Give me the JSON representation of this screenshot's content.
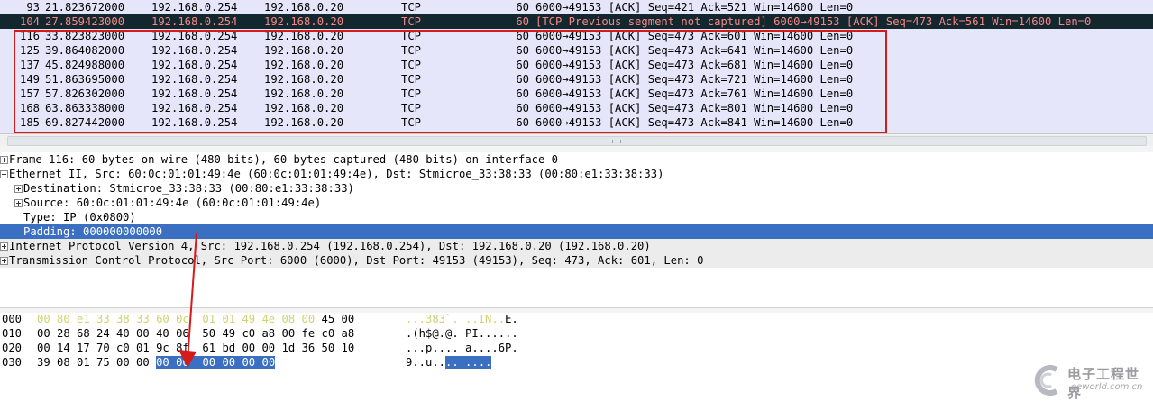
{
  "packet_list": {
    "rows": [
      {
        "no": "93",
        "time": "21.823672000",
        "src": "192.168.0.254",
        "dst": "192.168.0.20",
        "proto": "TCP",
        "len": "60",
        "info": "6000→49153 [ACK] Seq=421 Ack=521 Win=14600 Len=0",
        "style": "normal"
      },
      {
        "no": "104",
        "time": "27.859423000",
        "src": "192.168.0.254",
        "dst": "192.168.0.20",
        "proto": "TCP",
        "len": "60",
        "info": "[TCP Previous segment not captured] 6000→49153 [ACK] Seq=473 Ack=561 Win=14600 Len=0",
        "style": "dark"
      },
      {
        "no": "116",
        "time": "33.823823000",
        "src": "192.168.0.254",
        "dst": "192.168.0.20",
        "proto": "TCP",
        "len": "60",
        "info": "6000→49153 [ACK] Seq=473 Ack=601 Win=14600 Len=0",
        "style": "normal"
      },
      {
        "no": "125",
        "time": "39.864082000",
        "src": "192.168.0.254",
        "dst": "192.168.0.20",
        "proto": "TCP",
        "len": "60",
        "info": "6000→49153 [ACK] Seq=473 Ack=641 Win=14600 Len=0",
        "style": "normal"
      },
      {
        "no": "137",
        "time": "45.824988000",
        "src": "192.168.0.254",
        "dst": "192.168.0.20",
        "proto": "TCP",
        "len": "60",
        "info": "6000→49153 [ACK] Seq=473 Ack=681 Win=14600 Len=0",
        "style": "normal"
      },
      {
        "no": "149",
        "time": "51.863695000",
        "src": "192.168.0.254",
        "dst": "192.168.0.20",
        "proto": "TCP",
        "len": "60",
        "info": "6000→49153 [ACK] Seq=473 Ack=721 Win=14600 Len=0",
        "style": "normal"
      },
      {
        "no": "157",
        "time": "57.826302000",
        "src": "192.168.0.254",
        "dst": "192.168.0.20",
        "proto": "TCP",
        "len": "60",
        "info": "6000→49153 [ACK] Seq=473 Ack=761 Win=14600 Len=0",
        "style": "normal"
      },
      {
        "no": "168",
        "time": "63.863338000",
        "src": "192.168.0.254",
        "dst": "192.168.0.20",
        "proto": "TCP",
        "len": "60",
        "info": "6000→49153 [ACK] Seq=473 Ack=801 Win=14600 Len=0",
        "style": "normal"
      },
      {
        "no": "185",
        "time": "69.827442000",
        "src": "192.168.0.254",
        "dst": "192.168.0.20",
        "proto": "TCP",
        "len": "60",
        "info": "6000→49153 [ACK] Seq=473 Ack=841 Win=14600 Len=0",
        "style": "normal"
      }
    ]
  },
  "details": {
    "rows": [
      {
        "text": "Frame 116: 60 bytes on wire (480 bits), 60 bytes captured (480 bits) on interface 0",
        "toggle": "plus",
        "level": 0
      },
      {
        "text": "Ethernet II, Src: 60:0c:01:01:49:4e (60:0c:01:01:49:4e), Dst: Stmicroe_33:38:33 (00:80:e1:33:38:33)",
        "toggle": "minus",
        "level": 0
      },
      {
        "text": "Destination: Stmicroe_33:38:33 (00:80:e1:33:38:33)",
        "toggle": "plus",
        "level": 1
      },
      {
        "text": "Source: 60:0c:01:01:49:4e (60:0c:01:01:49:4e)",
        "toggle": "plus",
        "level": 1
      },
      {
        "text": "Type: IP (0x0800)",
        "toggle": "none",
        "level": 1
      },
      {
        "text": "Padding: 000000000000",
        "toggle": "none",
        "level": 1,
        "selected": true
      },
      {
        "text": "Internet Protocol Version 4, Src: 192.168.0.254 (192.168.0.254), Dst: 192.168.0.20 (192.168.0.20)",
        "toggle": "plus",
        "level": 0
      },
      {
        "text": "Transmission Control Protocol, Src Port: 6000 (6000), Dst Port: 49153 (49153), Seq: 473, Ack: 601, Len: 0",
        "toggle": "plus",
        "level": 0
      }
    ]
  },
  "bytes": {
    "rows": [
      {
        "offset": "000",
        "hex": [
          {
            "t": "00 80 e1 33 38 33 60 0c  01 01 49 4e 08 00",
            "c": "dim"
          },
          {
            "t": " 45 00",
            "c": ""
          }
        ],
        "ascii": [
          {
            "t": "...383`. ..IN..",
            "c": "dim"
          },
          {
            "t": "E.",
            "c": ""
          }
        ]
      },
      {
        "offset": "010",
        "hex": [
          {
            "t": "00 28 68 24 40 00 40 06  50 49 c0 a8 00 fe c0 a8",
            "c": ""
          }
        ],
        "ascii": [
          {
            "t": ".(h$@.@. PI......",
            "c": ""
          }
        ]
      },
      {
        "offset": "020",
        "hex": [
          {
            "t": "00 14 17 70 c0 01 9c 8f  61 bd 00 00 1d 36 50 10",
            "c": ""
          }
        ],
        "ascii": [
          {
            "t": "...p.... a....6P.",
            "c": ""
          }
        ]
      },
      {
        "offset": "030",
        "hex": [
          {
            "t": "39 08 01 75 00 00 ",
            "c": ""
          },
          {
            "t": "00 00  00 00 00 00",
            "c": "hl"
          }
        ],
        "ascii": [
          {
            "t": "9..u..",
            "c": ""
          },
          {
            "t": ".. ....",
            "c": "hl"
          }
        ]
      }
    ]
  },
  "watermark": {
    "cn": "电子工程世界",
    "en": "eeworld.com.cn"
  },
  "colors": {
    "list_bg": "#e6e6fa",
    "dark_row_bg": "#12272e",
    "dark_row_fg": "#f78787",
    "selection": "#3a6fc2",
    "annotation_red": "#d51a1a"
  }
}
